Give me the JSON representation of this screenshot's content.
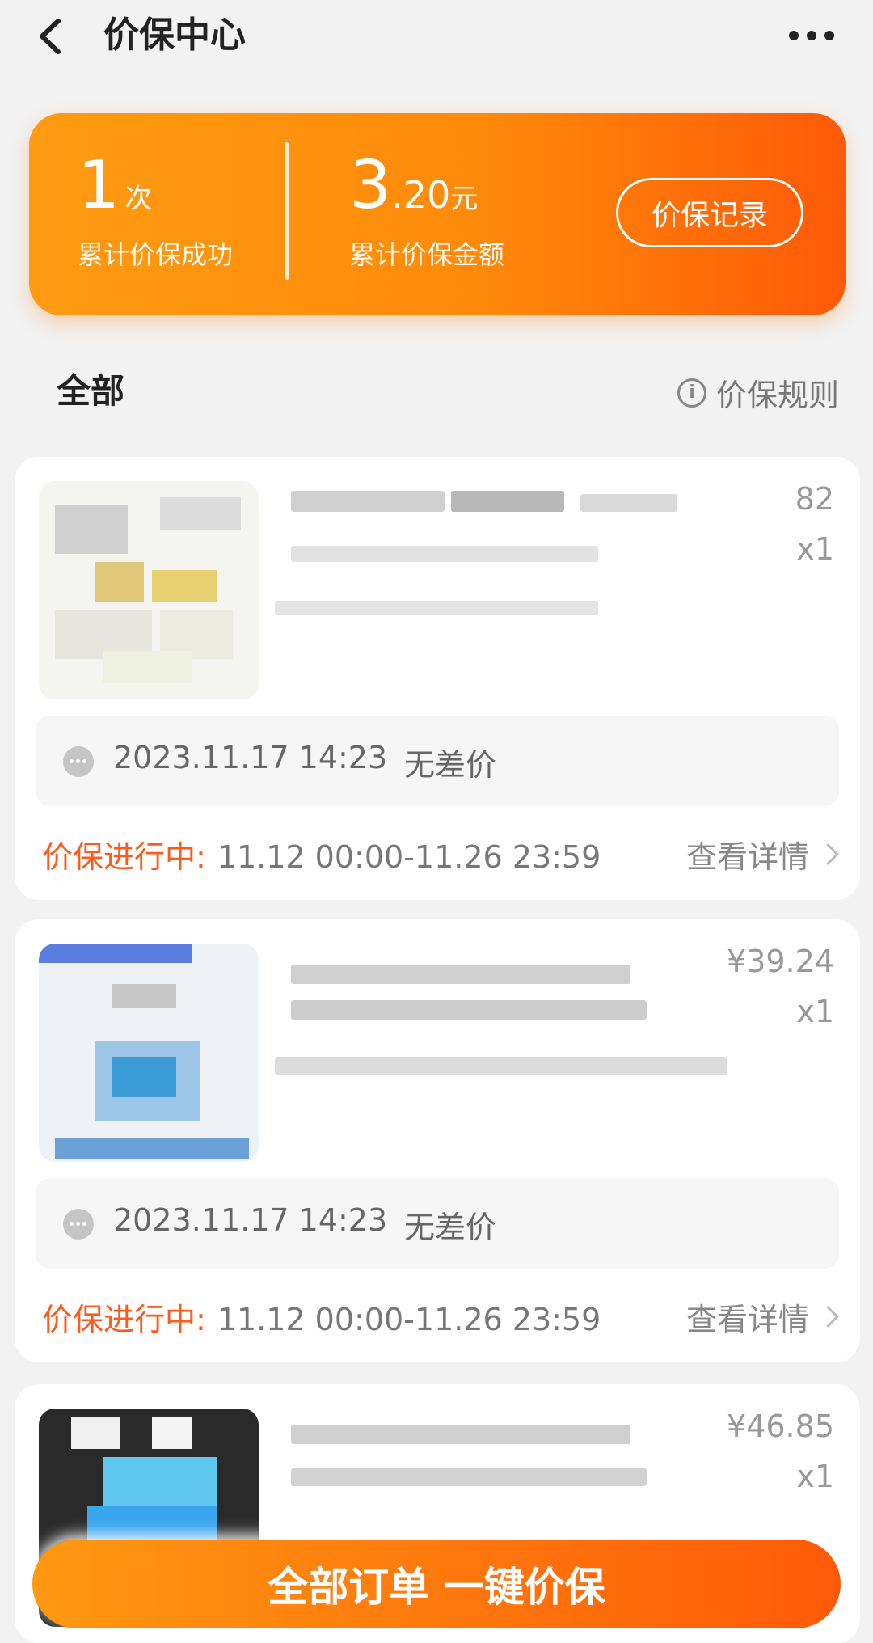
{
  "header": {
    "title": "价保中心"
  },
  "summary": {
    "count_value": "1",
    "count_unit": "次",
    "count_label": "累计价保成功",
    "amount_value": "3",
    "amount_decimal": ".20",
    "amount_unit": "元",
    "amount_label": "累计价保金额",
    "record_button": "价保记录"
  },
  "section": {
    "title": "全部",
    "rules_label": "价保规则",
    "info_glyph": "i"
  },
  "cards": [
    {
      "price": "82",
      "qty": "x1",
      "check_date": "2023.11.17 14:23",
      "check_note": "无差价",
      "status_label": "价保进行中:",
      "status_range": "11.12 00:00-11.26 23:59",
      "detail_label": "查看详情"
    },
    {
      "price": "¥39.24",
      "qty": "x1",
      "check_date": "2023.11.17 14:23",
      "check_note": "无差价",
      "status_label": "价保进行中:",
      "status_range": "11.12 00:00-11.26 23:59",
      "detail_label": "查看详情"
    },
    {
      "price": "¥46.85",
      "qty": "x1"
    }
  ],
  "bottom_button": "全部订单 一键价保",
  "colors": {
    "accent": "#ff8a0a",
    "accent_dark": "#ff5a08",
    "status": "#ff5a1a"
  }
}
